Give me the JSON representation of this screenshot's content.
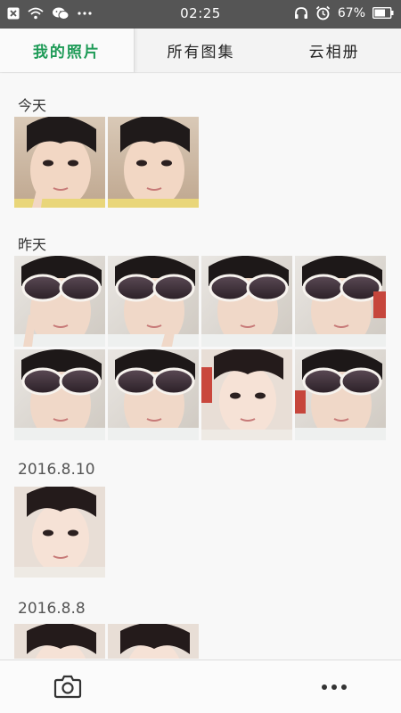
{
  "status_bar": {
    "time": "02:25",
    "battery": "67%",
    "icons": [
      "close-notification-icon",
      "wifi-icon",
      "wechat-icon",
      "more-dots-icon",
      "headphone-icon",
      "alarm-icon",
      "battery-icon"
    ]
  },
  "tabs": [
    {
      "label": "我的照片",
      "active": true
    },
    {
      "label": "所有图集",
      "active": false
    },
    {
      "label": "云相册",
      "active": false
    }
  ],
  "sections": [
    {
      "title": "今天",
      "photo_count": 2
    },
    {
      "title": "昨天",
      "photo_count": 8
    },
    {
      "title": "2016.8.10",
      "photo_count": 1
    },
    {
      "title": "2016.8.8",
      "photo_count": 2
    }
  ],
  "bottom_bar": {
    "left_icon": "camera-icon",
    "right_icon": "more-icon"
  },
  "colors": {
    "accent": "#1e9b57",
    "status_bar": "#555555"
  }
}
